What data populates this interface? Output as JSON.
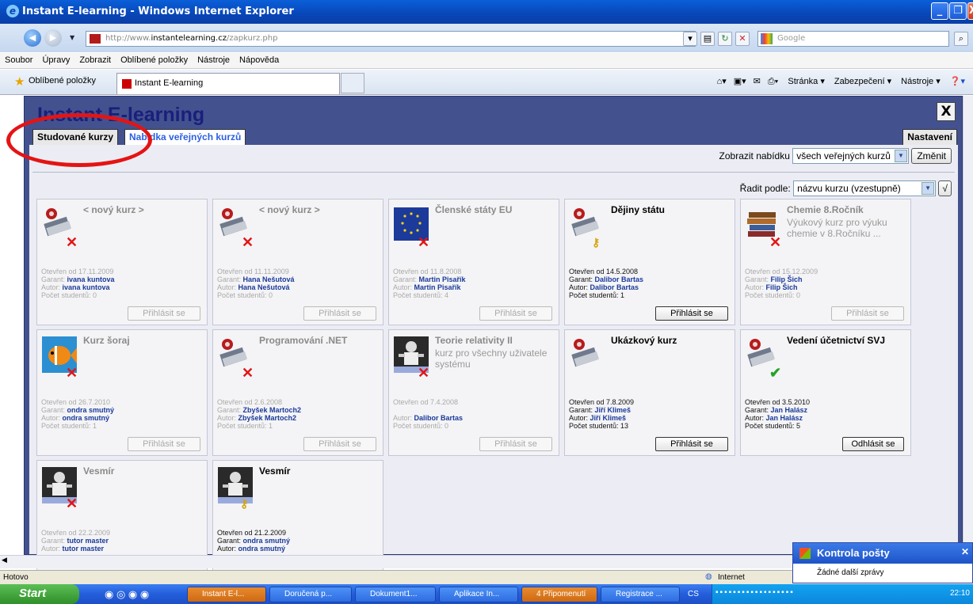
{
  "window": {
    "title": "Instant E-learning - Windows Internet Explorer",
    "url_prefix": "http://www.",
    "url_host": "instantelearning.cz",
    "url_path": "/zapkurz.php",
    "search_placeholder": "Google"
  },
  "menu": [
    "Soubor",
    "Úpravy",
    "Zobrazit",
    "Oblíbené položky",
    "Nástroje",
    "Nápověda"
  ],
  "favorites": {
    "label": "Oblíbené položky",
    "tab_title": "Instant E-learning",
    "commands": [
      "Stránka ▾",
      "Zabezpečení ▾",
      "Nástroje ▾"
    ]
  },
  "app": {
    "title": "Instant E-learning",
    "close": "X",
    "tabs": {
      "studied": "Studované kurzy",
      "public": "Nabídka veřejných kurzů",
      "settings": "Nastavení"
    },
    "show_label": "Zobrazit nabídku",
    "show_value": "všech veřejných kurzů",
    "show_button": "Změnit",
    "sort_label": "Řadit podle:",
    "sort_value": "názvu kurzu (vzestupně)",
    "sort_button": "√"
  },
  "courses": [
    {
      "title": "< nový kurz >",
      "desc": "",
      "opened": "Otevřen od 17.11.2009",
      "garant": "ivana kuntova",
      "autor": "ivana kuntova",
      "students": "Počet studentů: 0",
      "button": "Přihlásit se",
      "active": false,
      "icon": "book-locked-icon",
      "status": "x"
    },
    {
      "title": "< nový kurz >",
      "desc": "",
      "opened": "Otevřen od 11.11.2009",
      "garant": "Hana Nešutová",
      "autor": "Hana Nešutová",
      "students": "Počet studentů: 0",
      "button": "Přihlásit se",
      "active": false,
      "icon": "book-locked-icon",
      "status": "x"
    },
    {
      "title": "Členské státy EU",
      "desc": "",
      "opened": "Otevřen od 11.8.2008",
      "garant": "Martin Pisařík",
      "autor": "Martin Pisařík",
      "students": "Počet studentů: 4",
      "button": "Přihlásit se",
      "active": false,
      "icon": "eu-flag-icon",
      "status": "x"
    },
    {
      "title": "Dějiny státu",
      "desc": "",
      "opened": "Otevřen od 14.5.2008",
      "garant": "Dalibor Bartas",
      "autor": "Dalibor Bartas",
      "students": "Počet studentů: 1",
      "button": "Přihlásit se",
      "active": true,
      "icon": "book-locked-icon",
      "status": "key"
    },
    {
      "title": "Chemie 8.Ročník",
      "desc": "Výukový kurz pro výuku chemie v 8.Ročníku ...",
      "opened": "Otevřen od 15.12.2009",
      "garant": "Filip Šich",
      "autor": "Filip Šich",
      "students": "Počet studentů: 0",
      "button": "Přihlásit se",
      "active": false,
      "icon": "books-stack-icon",
      "status": "x"
    },
    {
      "title": "Kurz šoraj",
      "desc": "",
      "opened": "Otevřen od 26.7.2010",
      "garant": "ondra smutný",
      "autor": "ondra smutný",
      "students": "Počet studentů: 1",
      "button": "Přihlásit se",
      "active": false,
      "icon": "fish-icon",
      "status": "x"
    },
    {
      "title": "Programování .NET",
      "desc": "",
      "opened": "Otevřen od 2.6.2008",
      "garant": "Zbyšek Martoch2",
      "autor": "Zbyšek Martoch2",
      "students": "Počet studentů: 1",
      "button": "Přihlásit se",
      "active": false,
      "icon": "book-locked-icon",
      "status": "x"
    },
    {
      "title": "Teorie relativity II",
      "desc": "kurz pro všechny uživatele systému",
      "opened": "Otevřen od 7.4.2008",
      "garant": "",
      "autor": "Dalibor Bartas",
      "students": "Počet studentů: 0",
      "button": "Přihlásit se",
      "active": false,
      "icon": "astronaut-icon",
      "status": "x"
    },
    {
      "title": "Ukázkový kurz",
      "desc": "",
      "opened": "Otevřen od 7.8.2009",
      "garant": "Jiří Klimeš",
      "autor": "Jiří Klimeš",
      "students": "Počet studentů: 13",
      "button": "Přihlásit se",
      "active": true,
      "icon": "book-locked-icon",
      "status": "none"
    },
    {
      "title": "Vedení účetnictví SVJ",
      "desc": "",
      "opened": "Otevřen od 3.5.2010",
      "garant": "Jan Halász",
      "autor": "Jan Halász",
      "students": "Počet studentů: 5",
      "button": "Odhlásit se",
      "active": true,
      "icon": "book-locked-icon",
      "status": "check"
    },
    {
      "title": "Vesmír",
      "desc": "",
      "opened": "Otevřen od 22.2.2009",
      "garant": "tutor master",
      "autor": "tutor master",
      "students": "",
      "button": "",
      "active": false,
      "icon": "astronaut-icon",
      "status": "x"
    },
    {
      "title": "Vesmír",
      "desc": "",
      "opened": "Otevřen od 21.2.2009",
      "garant": "ondra smutný",
      "autor": "ondra smutný",
      "students": "",
      "button": "",
      "active": true,
      "icon": "astronaut-icon",
      "status": "key"
    }
  ],
  "labels": {
    "garant": "Garant:",
    "autor": "Autor:"
  },
  "status": {
    "left": "Hotovo",
    "zone": "Internet"
  },
  "popup": {
    "title": "Kontrola pošty",
    "body": "Žádné další zprávy"
  },
  "taskbar": {
    "start": "Start",
    "items": [
      "Instant E-l...",
      "Doručená p...",
      "Dokument1...",
      "Aplikace In...",
      "4 Připomenutí",
      "Registrace ..."
    ],
    "lang": "CS",
    "clock": "22:10"
  },
  "colors": {
    "app_bg": "#43528f",
    "title_blue": "#1a1f7a",
    "link_blue": "#2c5fe0",
    "annotation_red": "#e41414"
  }
}
